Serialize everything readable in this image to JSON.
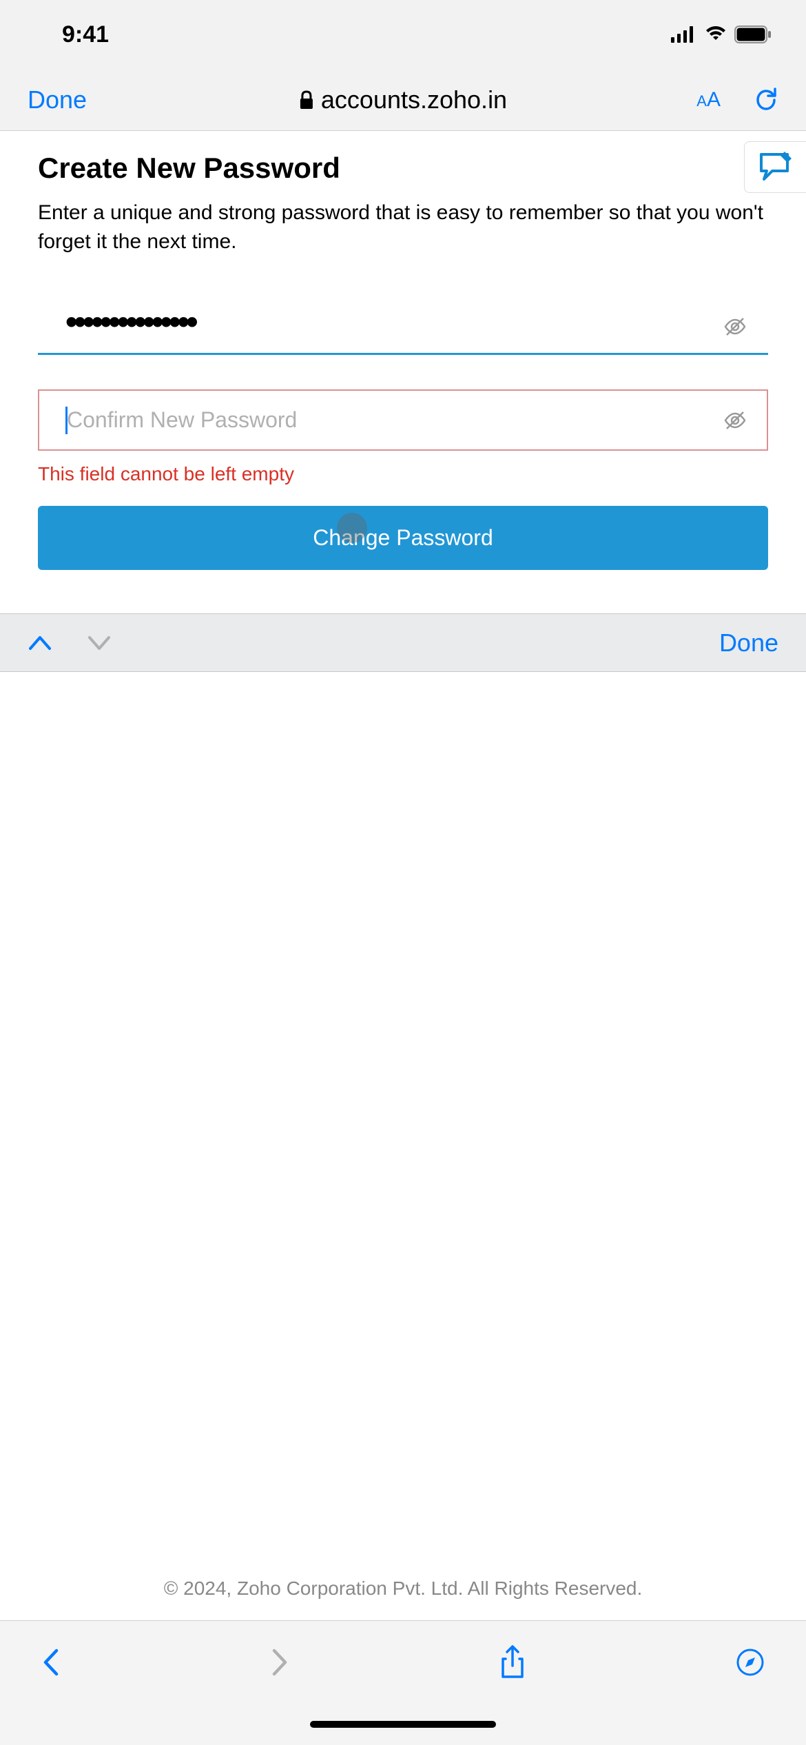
{
  "status": {
    "time": "9:41"
  },
  "browser": {
    "done_label": "Done",
    "url": "accounts.zoho.in"
  },
  "page": {
    "title": "Create New Password",
    "description": "Enter a unique and strong password that is easy to remember so that you won't forget it the next time."
  },
  "form": {
    "password_value": "•••••••••••••••",
    "confirm_placeholder": "Confirm New Password",
    "confirm_value": "",
    "error_message": "This field cannot be left empty",
    "submit_label": "Change Password"
  },
  "keyboard": {
    "done_label": "Done"
  },
  "footer": {
    "copyright": "© 2024, Zoho Corporation Pvt. Ltd. All Rights Reserved."
  }
}
